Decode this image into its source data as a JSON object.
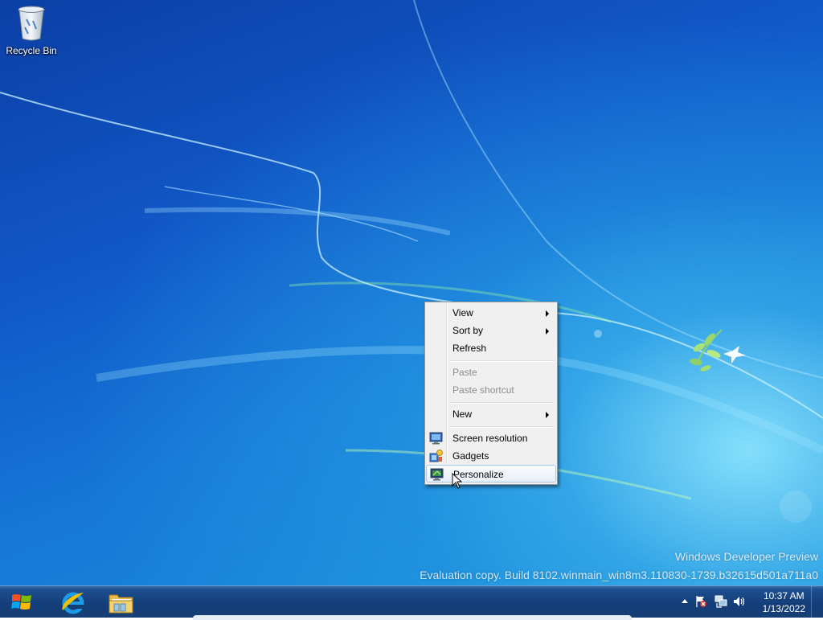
{
  "desktop": {
    "icons": [
      {
        "label": "Recycle Bin",
        "icon": "recycle-bin-icon"
      }
    ],
    "watermark": {
      "line1": "Windows Developer Preview",
      "line2": "Evaluation copy. Build 8102.winmain_win8m3.110830-1739.b32615d501a711a0"
    }
  },
  "context_menu": {
    "items": [
      {
        "label": "View",
        "submenu": true
      },
      {
        "label": "Sort by",
        "submenu": true
      },
      {
        "label": "Refresh"
      },
      {
        "label": "Paste",
        "disabled": true
      },
      {
        "label": "Paste shortcut",
        "disabled": true
      },
      {
        "label": "New",
        "submenu": true
      },
      {
        "label": "Screen resolution",
        "icon": "screen-resolution-icon"
      },
      {
        "label": "Gadgets",
        "icon": "gadgets-icon"
      },
      {
        "label": "Personalize",
        "icon": "personalize-icon",
        "highlighted": true
      }
    ]
  },
  "taskbar": {
    "pinned": [
      {
        "name": "Internet Explorer",
        "icon": "internet-explorer-icon"
      },
      {
        "name": "Windows Explorer",
        "icon": "folder-icon"
      }
    ],
    "clock": {
      "time": "10:37 AM",
      "date": "1/13/2022"
    }
  }
}
